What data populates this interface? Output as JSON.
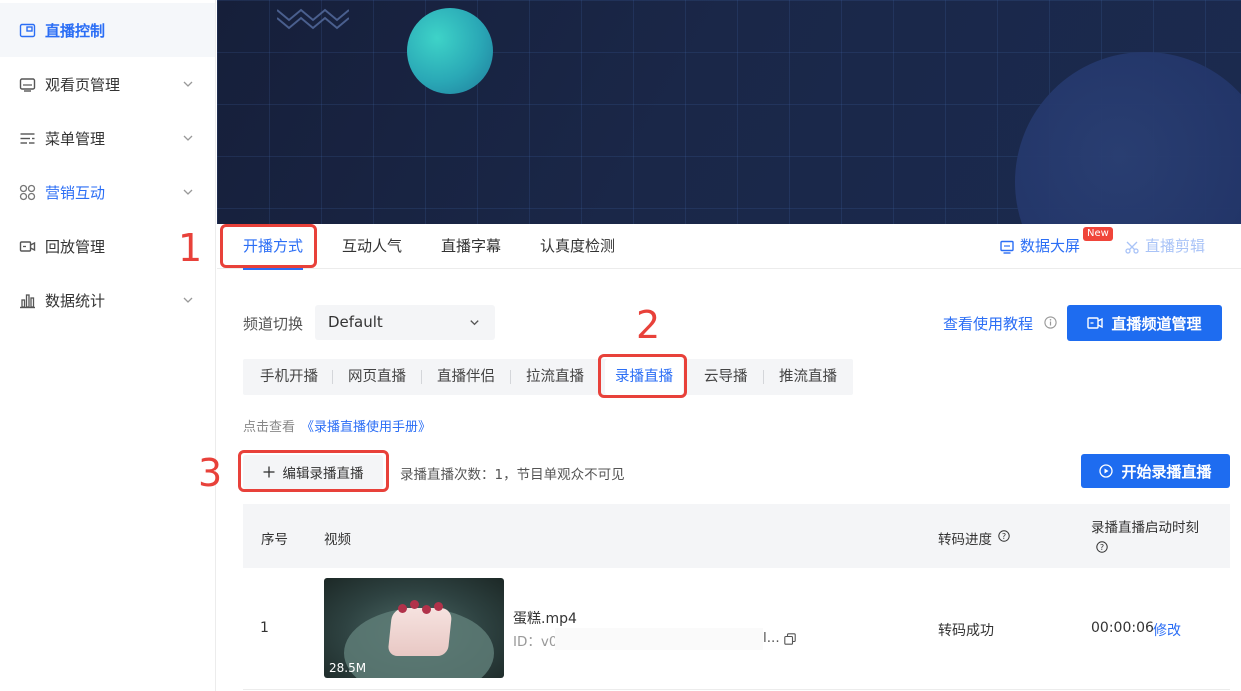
{
  "sidebar": {
    "items": [
      {
        "label": "直播控制",
        "icon": "live-control-icon"
      },
      {
        "label": "观看页管理",
        "icon": "monitor-icon"
      },
      {
        "label": "菜单管理",
        "icon": "menu-list-icon"
      },
      {
        "label": "营销互动",
        "icon": "grid-icon"
      },
      {
        "label": "回放管理",
        "icon": "video-camera-icon"
      },
      {
        "label": "数据统计",
        "icon": "bar-chart-icon"
      }
    ]
  },
  "tabs": {
    "items": [
      "开播方式",
      "互动人气",
      "直播字幕",
      "认真度检测"
    ],
    "active": "开播方式",
    "data_screen": "数据大屏",
    "new_badge": "New",
    "live_clip": "直播剪辑"
  },
  "channel": {
    "label": "频道切换",
    "value": "Default",
    "tutorial_link": "查看使用教程",
    "manage_button": "直播频道管理"
  },
  "modes": {
    "items": [
      "手机开播",
      "网页直播",
      "直播伴侣",
      "拉流直播",
      "录播直播",
      "云导播",
      "推流直播"
    ],
    "active": "录播直播"
  },
  "hint": {
    "prefix": "点击查看",
    "link": "《录播直播使用手册》"
  },
  "recorded": {
    "edit_button": "编辑录播直播",
    "count_text": "录播直播次数：1，节目单观众不可见",
    "start_button": "开始录播直播"
  },
  "table": {
    "headers": [
      "序号",
      "视频",
      "转码进度",
      "录播直播启动时刻"
    ],
    "rows": [
      {
        "index": "1",
        "file_name": "蛋糕.mp4",
        "id_prefix": "ID：v0",
        "id_suffix": "l...",
        "size": "28.5M",
        "status": "转码成功",
        "start_time": "00:00:06",
        "edit_link": "修改"
      }
    ]
  },
  "annotations": [
    "1",
    "2",
    "3"
  ],
  "colors": {
    "accent": "#2b6ef5",
    "primary_button": "#1e6cf0",
    "annotation": "#e8413a",
    "badge": "#f0453a"
  }
}
